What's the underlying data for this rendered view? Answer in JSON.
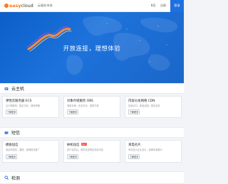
{
  "header": {
    "logo": {
      "part1": "easy",
      "part2": "cloud"
    },
    "brand_sub": "云服务市场",
    "links": [
      "8月",
      "注册"
    ],
    "cta": "登录"
  },
  "hero": {
    "title": "开放连接，理想体验"
  },
  "sections": [
    {
      "title": "云主机",
      "cards": [
        {
          "title": "弹性云服务器 ECS",
          "desc": "云计算服务，稳定可靠，弹性伸缩",
          "button": "了解更多"
        },
        {
          "title": "对象存储服务 OBS",
          "desc": "海量存储，安全可靠，按需付费",
          "button": "了解更多"
        },
        {
          "title": "内容分发网络 CDN",
          "desc": "加速访问，覆盖全国，稳定高效",
          "button": "了解更多"
        }
      ]
    },
    {
      "title": "短信",
      "cards": [
        {
          "title": "模板短信",
          "desc": "验证码短信、通知、营销短信推广",
          "button": "了解更多"
        },
        {
          "title": "掉机短信",
          "badge": "HOT",
          "desc": "用户挂机后，即时发送短信消息内容",
          "button": "了解更多"
        },
        {
          "title": "来电名片",
          "desc": "来电显示企业名片，品牌形象展示",
          "button": "了解更多"
        }
      ]
    },
    {
      "title": "检测",
      "cards": []
    }
  ]
}
